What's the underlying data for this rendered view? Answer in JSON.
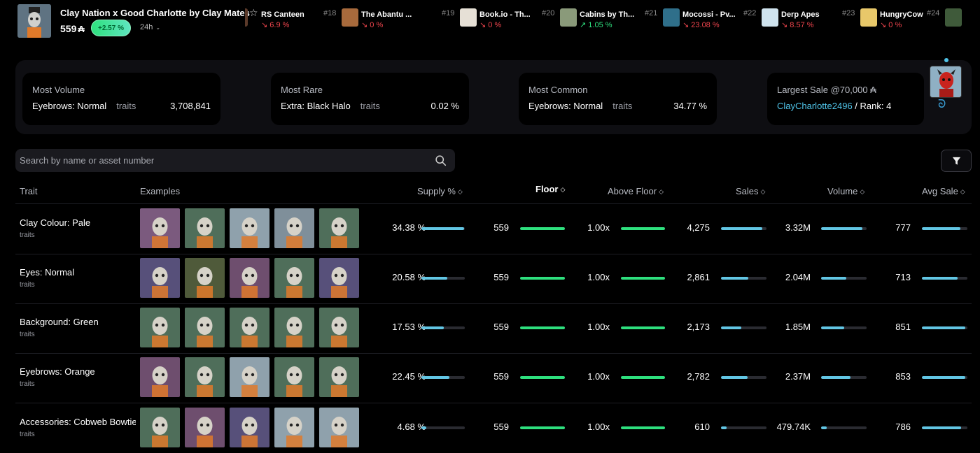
{
  "header": {
    "collection_name": "Clay Nation x Good Charlotte by Clay Mates",
    "floor_price": "559",
    "currency_symbol": "₳",
    "change": "+2.57 %",
    "range": "24h"
  },
  "ticker": [
    {
      "rank": "",
      "name": "RS Canteen",
      "change": "↘ 6.9 %",
      "dir": "down",
      "color": "#5b3a2a"
    },
    {
      "rank": "#18",
      "name": "The Abantu ...",
      "change": "↘ 0 %",
      "dir": "down",
      "color": "#a86a3c"
    },
    {
      "rank": "#19",
      "name": "Book.io - Th...",
      "change": "↘ 0 %",
      "dir": "down",
      "color": "#e6e0d6"
    },
    {
      "rank": "#20",
      "name": "Cabins by Th...",
      "change": "↗ 1.05 %",
      "dir": "up",
      "color": "#8a9a7a"
    },
    {
      "rank": "#21",
      "name": "Mocossi - Pv...",
      "change": "↘ 23.08 %",
      "dir": "down",
      "color": "#2f6f8a"
    },
    {
      "rank": "#22",
      "name": "Derp Apes",
      "change": "↘ 8.57 %",
      "dir": "down",
      "color": "#cfe3ee"
    },
    {
      "rank": "#23",
      "name": "HungryCow",
      "change": "↘ 0 %",
      "dir": "down",
      "color": "#e8c86a"
    },
    {
      "rank": "#24",
      "name": "",
      "change": "",
      "dir": "down",
      "color": "#3f5a3a"
    }
  ],
  "stats": {
    "most_volume": {
      "label": "Most Volume",
      "trait": "Eyebrows: Normal",
      "sub": "traits",
      "value": "3,708,841"
    },
    "most_rare": {
      "label": "Most Rare",
      "trait": "Extra: Black Halo",
      "sub": "traits",
      "value": "0.02 %"
    },
    "most_common": {
      "label": "Most Common",
      "trait": "Eyebrows: Normal",
      "sub": "traits",
      "value": "34.77 %"
    },
    "largest_sale": {
      "label": "Largest Sale @70,000 ₳",
      "buyer": "ClayCharlotte2496",
      "rank_text": " / Rank: 4"
    }
  },
  "search": {
    "placeholder": "Search by name or asset number"
  },
  "columns": {
    "trait": "Trait",
    "examples": "Examples",
    "supply": "Supply %",
    "floor": "Floor",
    "above_floor": "Above Floor",
    "sales": "Sales",
    "volume": "Volume",
    "avg_sale": "Avg Sale"
  },
  "rows": [
    {
      "name": "Clay Colour: Pale",
      "sub": "traits",
      "thumbs": [
        "#7b5a7e",
        "#4f6e5a",
        "#8fa1ac",
        "#7f8f9a",
        "#4f6e5a"
      ],
      "supply": "34.38 %",
      "supply_level": 0.98,
      "floor": "559",
      "floor_level": 1.0,
      "above": "1.00x",
      "above_level": 1.0,
      "sales": "4,275",
      "sales_level": 0.9,
      "volume": "3.32M",
      "volume_level": 0.9,
      "avg": "777",
      "avg_level": 0.85
    },
    {
      "name": "Eyes: Normal",
      "sub": "traits",
      "thumbs": [
        "#57507a",
        "#4f5a3a",
        "#6e4e6e",
        "#4f6e5a",
        "#57507a"
      ],
      "supply": "20.58 %",
      "supply_level": 0.6,
      "floor": "559",
      "floor_level": 1.0,
      "above": "1.00x",
      "above_level": 1.0,
      "sales": "2,861",
      "sales_level": 0.6,
      "volume": "2.04M",
      "volume_level": 0.55,
      "avg": "713",
      "avg_level": 0.78
    },
    {
      "name": "Background: Green",
      "sub": "traits",
      "thumbs": [
        "#4f6e5a",
        "#4f6e5a",
        "#4f6e5a",
        "#4f6e5a",
        "#4f6e5a"
      ],
      "supply": "17.53 %",
      "supply_level": 0.51,
      "floor": "559",
      "floor_level": 1.0,
      "above": "1.00x",
      "above_level": 1.0,
      "sales": "2,173",
      "sales_level": 0.45,
      "volume": "1.85M",
      "volume_level": 0.5,
      "avg": "851",
      "avg_level": 0.95
    },
    {
      "name": "Eyebrows: Orange",
      "sub": "traits",
      "thumbs": [
        "#6e4e6e",
        "#4f6e5a",
        "#8fa1ac",
        "#4f6e5a",
        "#4f6e5a"
      ],
      "supply": "22.45 %",
      "supply_level": 0.65,
      "floor": "559",
      "floor_level": 1.0,
      "above": "1.00x",
      "above_level": 1.0,
      "sales": "2,782",
      "sales_level": 0.58,
      "volume": "2.37M",
      "volume_level": 0.64,
      "avg": "853",
      "avg_level": 0.95
    },
    {
      "name": "Accessories: Cobweb Bowtie",
      "sub": "traits",
      "thumbs": [
        "#4f6e5a",
        "#6e4e6e",
        "#57507a",
        "#8fa1ac",
        "#8fa1ac"
      ],
      "supply": "4.68 %",
      "supply_level": 0.12,
      "floor": "559",
      "floor_level": 1.0,
      "above": "1.00x",
      "above_level": 1.0,
      "sales": "610",
      "sales_level": 0.12,
      "volume": "479.74K",
      "volume_level": 0.13,
      "avg": "786",
      "avg_level": 0.86
    }
  ]
}
